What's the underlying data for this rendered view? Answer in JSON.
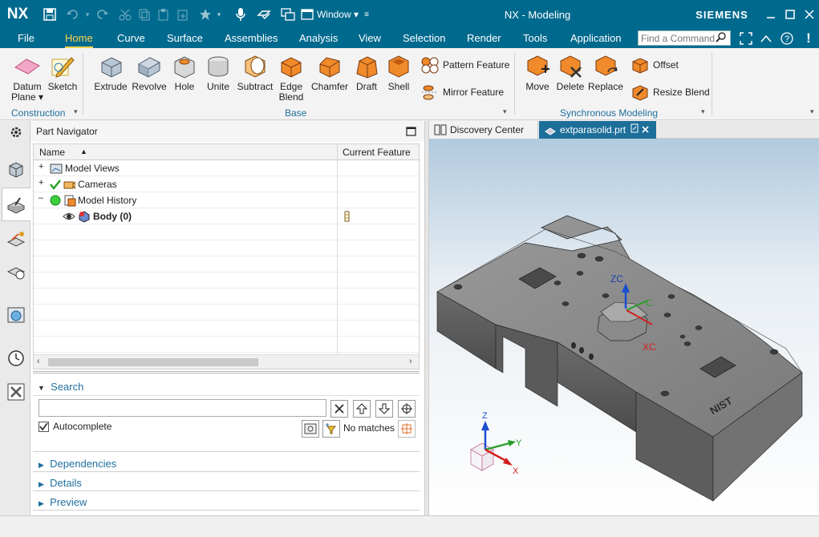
{
  "app": {
    "logo": "NX",
    "title": "NX - Modeling",
    "brand": "SIEMENS",
    "window_menu": "Window",
    "help_mark": "!"
  },
  "menu": [
    "File",
    "Home",
    "Curve",
    "Surface",
    "Assemblies",
    "Analysis",
    "View",
    "Selection",
    "Render",
    "Tools",
    "Application"
  ],
  "search": {
    "placeholder": "Find a Command"
  },
  "ribbon": {
    "construction": {
      "label": "Construction",
      "items": [
        {
          "label": "Datum",
          "label2": "Plane ▾"
        },
        {
          "label": "Sketch"
        }
      ]
    },
    "base": {
      "label": "Base",
      "items": [
        "Extrude",
        "Revolve",
        "Hole",
        "Unite",
        "Subtract",
        "Edge",
        "Chamfer",
        "Draft",
        "Shell"
      ],
      "edge_blend_second": "Blend",
      "small": [
        "Pattern Feature",
        "Mirror Feature"
      ]
    },
    "sync": {
      "label": "Synchronous Modeling",
      "items": [
        "Move",
        "Delete",
        "Replace"
      ],
      "small": [
        "Offset",
        "Resize Blend"
      ]
    }
  },
  "navigator": {
    "title": "Part Navigator",
    "columns": [
      "Name",
      "Current Feature"
    ],
    "rows": [
      {
        "name": "Model Views"
      },
      {
        "name": "Cameras"
      },
      {
        "name": "Model History"
      },
      {
        "name": "Body (0)"
      }
    ],
    "search_section": "Search",
    "autocomplete": "Autocomplete",
    "no_matches": "No matches",
    "sections": [
      "Dependencies",
      "Details",
      "Preview"
    ]
  },
  "viewport": {
    "tabs": [
      "Discovery Center",
      "extparasolid.prt"
    ],
    "axis": {
      "zc": "ZC",
      "yc": "YC",
      "xc": "XC",
      "z": "Z",
      "y": "Y",
      "x": "X"
    },
    "engraving": "NIST"
  },
  "colors": {
    "titlebar": "#006a8e",
    "accent": "#ffd24d",
    "link": "#1f6f9e"
  }
}
